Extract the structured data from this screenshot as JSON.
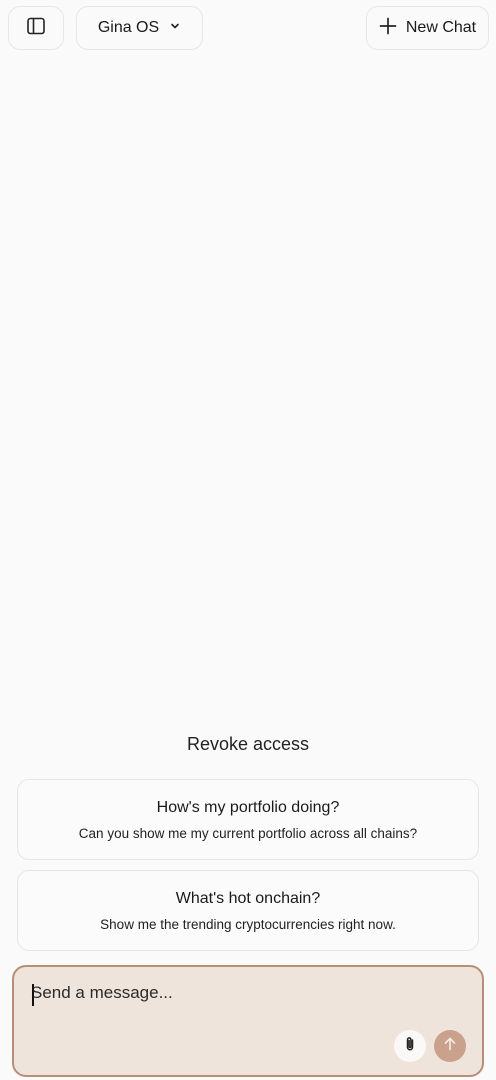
{
  "header": {
    "model_label": "Gina OS",
    "new_chat_label": "New Chat"
  },
  "revoke_label": "Revoke access",
  "suggestions": [
    {
      "title": "How's my portfolio doing?",
      "subtitle": "Can you show me my current portfolio across all chains?"
    },
    {
      "title": "What's hot onchain?",
      "subtitle": "Show me the trending cryptocurrencies right now."
    }
  ],
  "composer": {
    "placeholder": "Send a message...",
    "value": ""
  },
  "colors": {
    "background": "#fafafa",
    "composer_bg": "#efe4dc",
    "composer_border": "#b98e78",
    "send_button": "#c9a18d"
  },
  "icons": {
    "sidebar_toggle": "sidebar-panel-icon",
    "model_dropdown": "chevron-down-icon",
    "new_chat": "plus-icon",
    "attach": "paperclip-icon",
    "send": "arrow-up-icon"
  }
}
